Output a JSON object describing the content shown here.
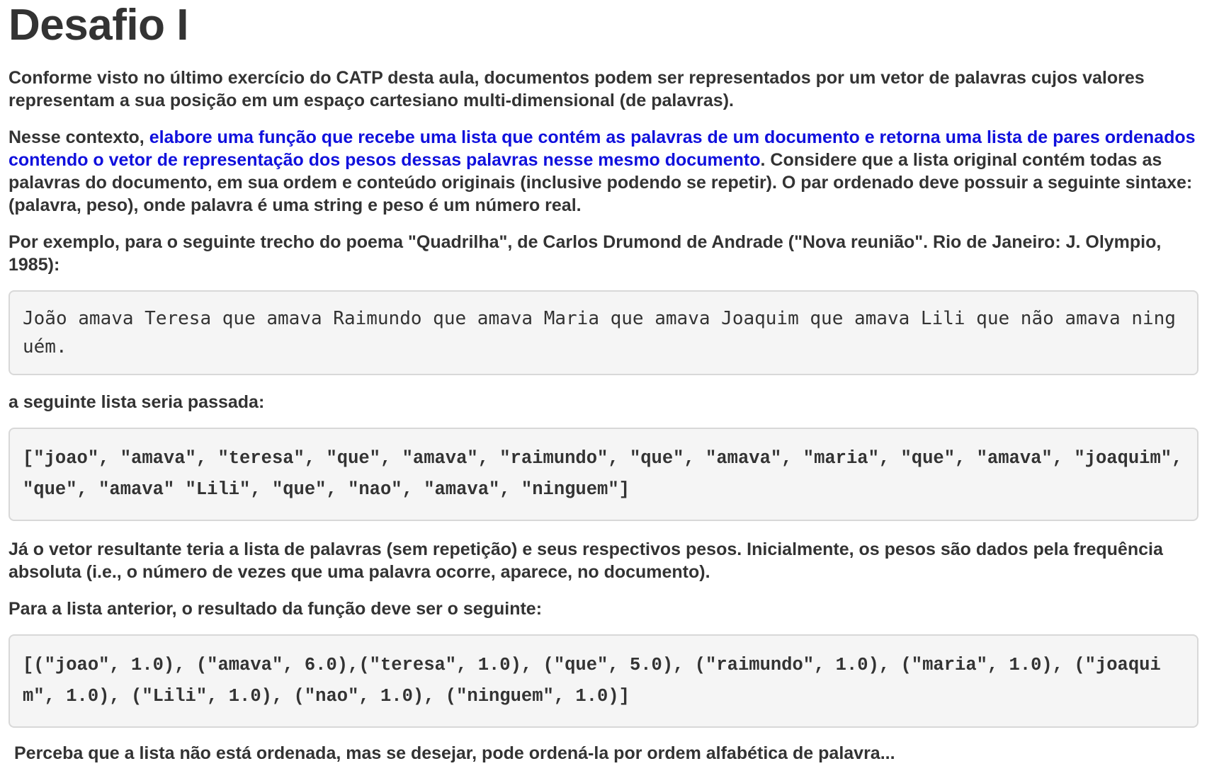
{
  "title": "Desafio I",
  "paragraph1": "Conforme visto no último exercício do CATP desta aula, documentos podem ser representados por um vetor de palavras cujos valores representam a sua posição em um espaço cartesiano multi-dimensional (de palavras).",
  "paragraph2": {
    "intro": "Nesse contexto, ",
    "highlight": "elabore uma função que recebe uma lista que contém as palavras de um documento e retorna uma lista de pares ordenados contendo o vetor de representação dos pesos dessas palavras nesse mesmo documento",
    "rest": ". Considere que a lista original contém todas as palavras do documento, em sua ordem e conteúdo originais (inclusive podendo se repetir). O par ordenado deve possuir a seguinte sintaxe: (palavra, peso), onde palavra é uma string e peso é um número real."
  },
  "paragraph3": "Por exemplo, para o seguinte trecho do poema \"Quadrilha\", de Carlos Drumond de Andrade (\"Nova reunião\". Rio de Janeiro: J. Olympio, 1985):",
  "poem_code": "João amava Teresa que amava Raimundo que amava Maria que amava Joaquim que amava Lili que não amava ninguém.",
  "paragraph4": "a seguinte lista seria passada:",
  "list_code": "[\"joao\", \"amava\", \"teresa\", \"que\", \"amava\", \"raimundo\", \"que\", \"amava\", \"maria\", \"que\", \"amava\", \"joaquim\", \"que\", \"amava\" \"Lili\", \"que\", \"nao\", \"amava\", \"ninguem\"]",
  "paragraph5": "Já o vetor resultante teria a lista de palavras (sem repetição) e seus respectivos pesos. Inicialmente, os pesos são dados pela frequência absoluta (i.e., o número de vezes que uma palavra ocorre, aparece, no documento).",
  "paragraph6": "Para a lista anterior, o resultado da função deve ser o seguinte:",
  "result_code": "[(\"joao\", 1.0), (\"amava\", 6.0),(\"teresa\", 1.0), (\"que\", 5.0), (\"raimundo\", 1.0), (\"maria\", 1.0), (\"joaquim\", 1.0), (\"Lili\", 1.0), (\"nao\", 1.0), (\"ninguem\", 1.0)]",
  "paragraph7": "Perceba que a lista não está ordenada, mas se desejar, pode ordená-la por ordem alfabética de palavra...",
  "colors": {
    "text": "#333333",
    "highlight": "#1010dd",
    "code_background": "#f5f5f5",
    "code_border": "#d8d8d8"
  }
}
